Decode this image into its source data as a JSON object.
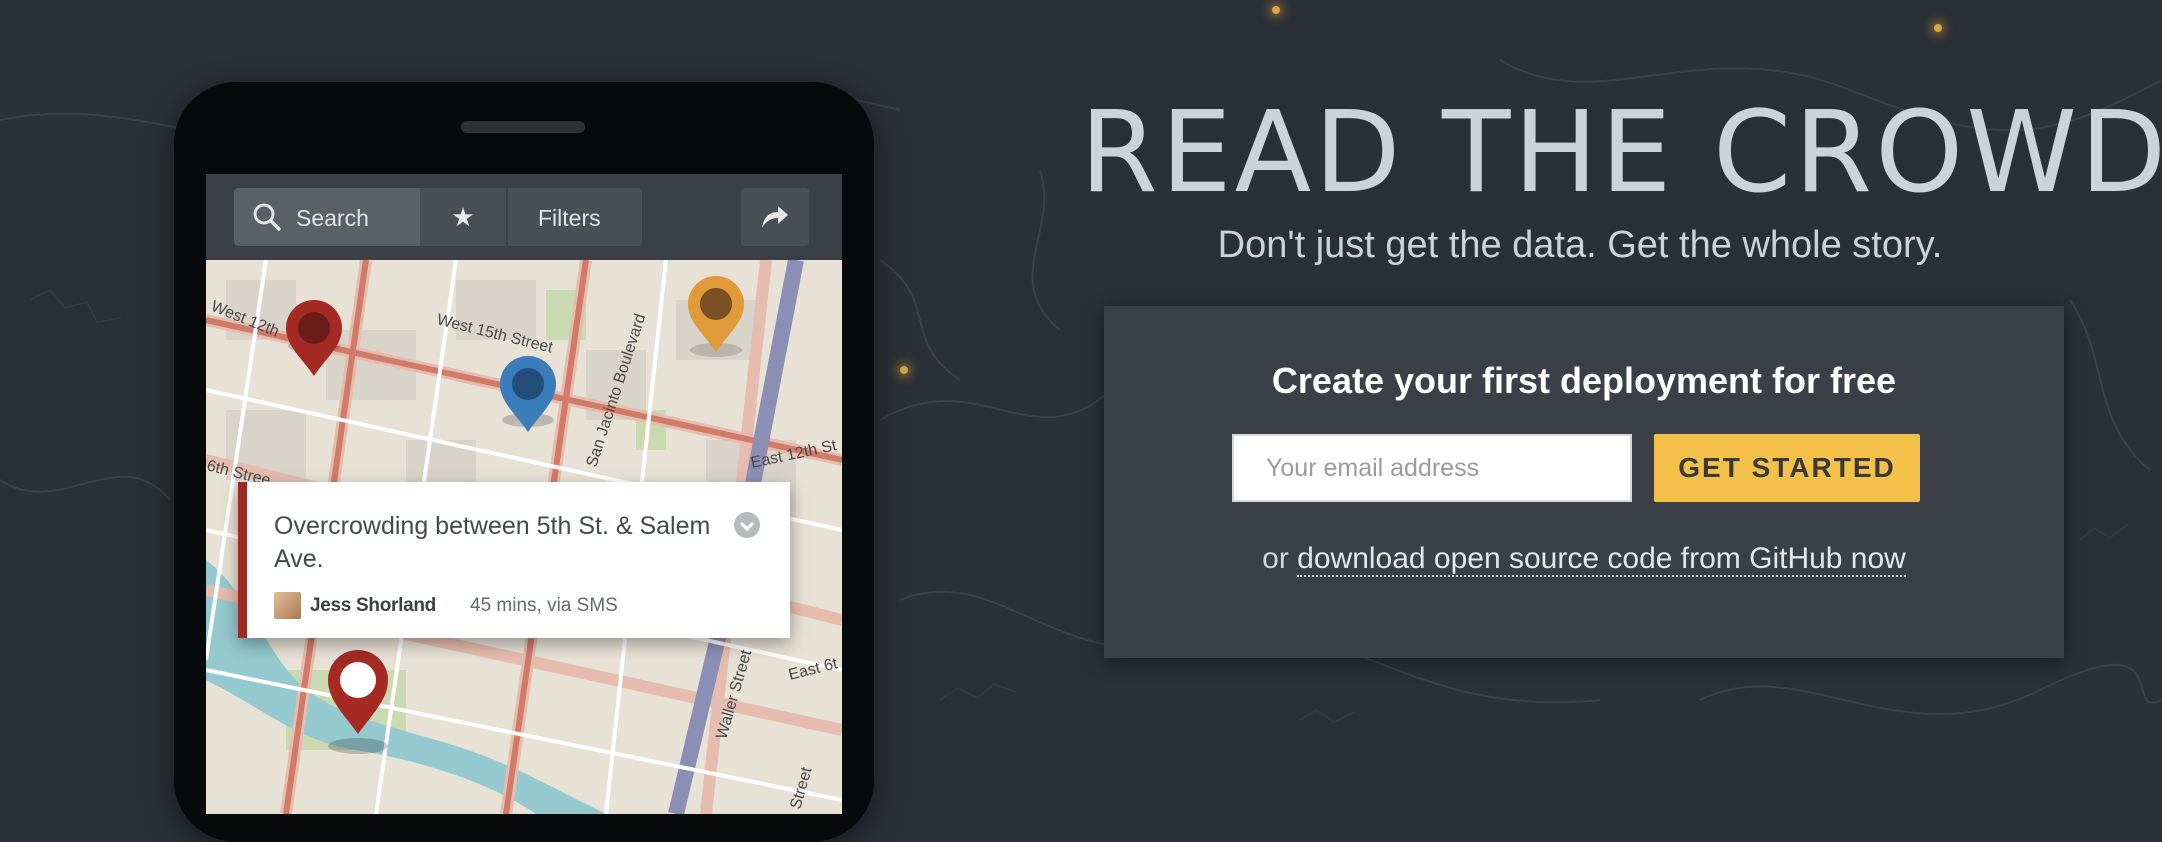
{
  "hero": {
    "title": "READ THE CROWD",
    "subtitle": "Don't just get the data. Get the whole story."
  },
  "cta": {
    "heading": "Create your first deployment for free",
    "email_placeholder": "Your email address",
    "button_label": "GET STARTED",
    "alt_prefix": "or ",
    "alt_link": "download open source code from GitHub now"
  },
  "phone_app": {
    "toolbar": {
      "search_label": "Search",
      "star_glyph": "★",
      "filters_label": "Filters"
    },
    "map_labels": {
      "street_1": "West 12th",
      "street_2": "West 15th Street",
      "street_3": "San Jacinto Boulevard",
      "street_4": "East 12th St",
      "street_5": "6th Stree",
      "street_6": "East 6t",
      "street_7": "Waller Street",
      "street_8": "Street"
    },
    "report_card": {
      "title": "Overcrowding between 5th St. & Salem Ave.",
      "author": "Jess Shorland",
      "meta": "45 mins, via SMS"
    },
    "pins": [
      {
        "name": "pin-red-dark",
        "color": "#a52a24",
        "status": "filled"
      },
      {
        "name": "pin-blue",
        "color": "#3b7dbb",
        "status": "filled"
      },
      {
        "name": "pin-orange",
        "color": "#e09a3a",
        "status": "filled"
      },
      {
        "name": "pin-red-selected",
        "color": "#a52a24",
        "status": "selected"
      }
    ]
  },
  "colors": {
    "background": "#2b2f37",
    "panel": "#3a3f48",
    "button": "#f3c04a",
    "accent": "#9b2b22"
  }
}
